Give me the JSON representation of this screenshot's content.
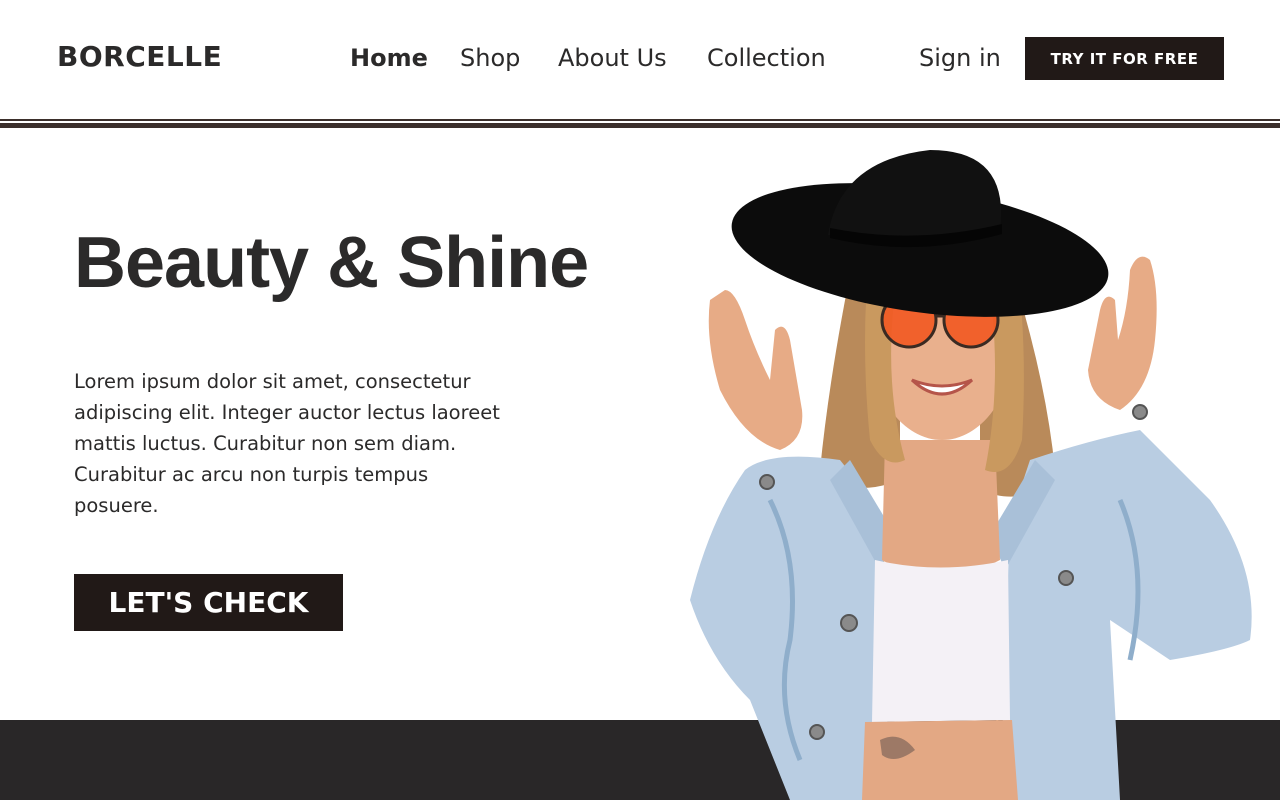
{
  "brand": {
    "name": "BORCELLE"
  },
  "nav": {
    "items": [
      {
        "label": "Home",
        "active": true
      },
      {
        "label": "Shop",
        "active": false
      },
      {
        "label": "About Us",
        "active": false
      },
      {
        "label": "Collection",
        "active": false
      }
    ]
  },
  "header": {
    "signin_label": "Sign in",
    "cta_label": "TRY IT FOR FREE"
  },
  "hero": {
    "title": "Beauty & Shine",
    "body": "Lorem ipsum dolor sit amet, consectetur adipiscing elit. Integer auctor lectus laoreet mattis luctus. Curabitur non sem diam. Curabitur ac arcu non turpis tempus posuere.",
    "button_label": "LET'S CHECK"
  },
  "colors": {
    "dark_button": "#211917",
    "text": "#2b2a2a",
    "footer_band": "#292728",
    "divider": "#3b2f2b"
  }
}
